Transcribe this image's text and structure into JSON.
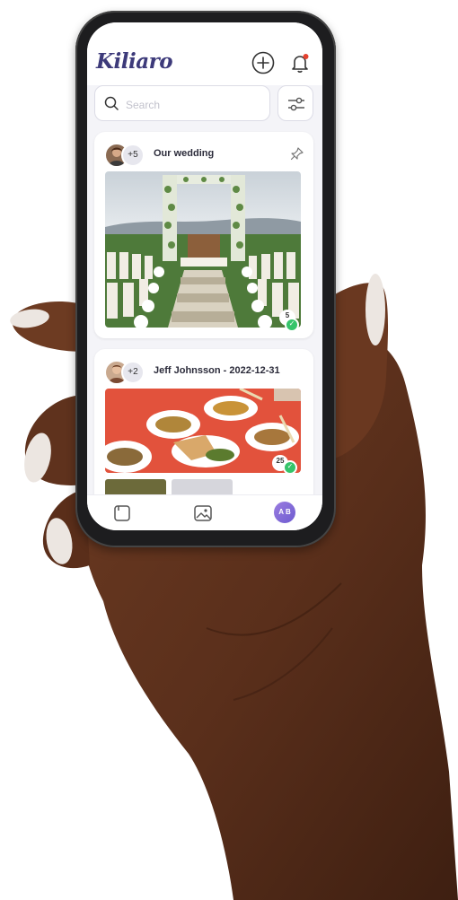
{
  "app": {
    "logo_text": "Kiliaro",
    "brand_color": "#3d3a7a",
    "header_icons": [
      "add-circle-icon",
      "bell-icon"
    ],
    "notification_dot_color": "#e5412f"
  },
  "search": {
    "placeholder": "Search",
    "icon": "search-icon",
    "filter_icon": "sliders-icon"
  },
  "feed": [
    {
      "extra_members": "+5",
      "title": "Our wedding",
      "action_icon": "pin-icon",
      "photo_count": "5",
      "photo": "wedding-ceremony-photo"
    },
    {
      "extra_members": "+2",
      "title": "Jeff Johnsson - 2022-12-31",
      "photo_count": "25",
      "photo": "food-plates-photo"
    }
  ],
  "bottom_nav": {
    "items": [
      "albums-icon",
      "photos-icon"
    ],
    "profile_initials": "A B"
  }
}
